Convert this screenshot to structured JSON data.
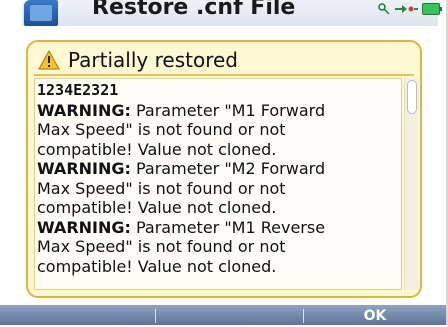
{
  "background_window": {
    "title": "Restore .cnf File"
  },
  "dialog": {
    "title": "Partially restored",
    "message_lines": [
      {
        "type": "code",
        "text": "1234E2321"
      },
      {
        "type": "warn",
        "prefix": "WARNING:",
        "text": " Parameter \"M1 Forward"
      },
      {
        "type": "plain",
        "text": "Max Speed\" is not found or not"
      },
      {
        "type": "plain",
        "text": "compatible! Value not cloned."
      },
      {
        "type": "warn",
        "prefix": "WARNING:",
        "text": " Parameter \"M2 Forward"
      },
      {
        "type": "plain",
        "text": "Max Speed\" is not found or not"
      },
      {
        "type": "plain",
        "text": "compatible! Value not cloned."
      },
      {
        "type": "warn",
        "prefix": "WARNING:",
        "text": " Parameter \"M1 Reverse"
      },
      {
        "type": "plain",
        "text": "Max Speed\" is not found or not"
      },
      {
        "type": "plain",
        "text": "compatible! Value not cloned."
      }
    ]
  },
  "softkeys": {
    "left": "",
    "middle": "",
    "right": "OK"
  },
  "icons": {
    "warning": "warning-triangle-icon",
    "usb": "usb-icon",
    "network": "network-icon",
    "battery": "battery-icon"
  },
  "colors": {
    "dialog_background": "#fff8d2",
    "dialog_border": "#e0b53a",
    "softkey_bar": "#6b82a6",
    "battery": "#39c45a"
  }
}
